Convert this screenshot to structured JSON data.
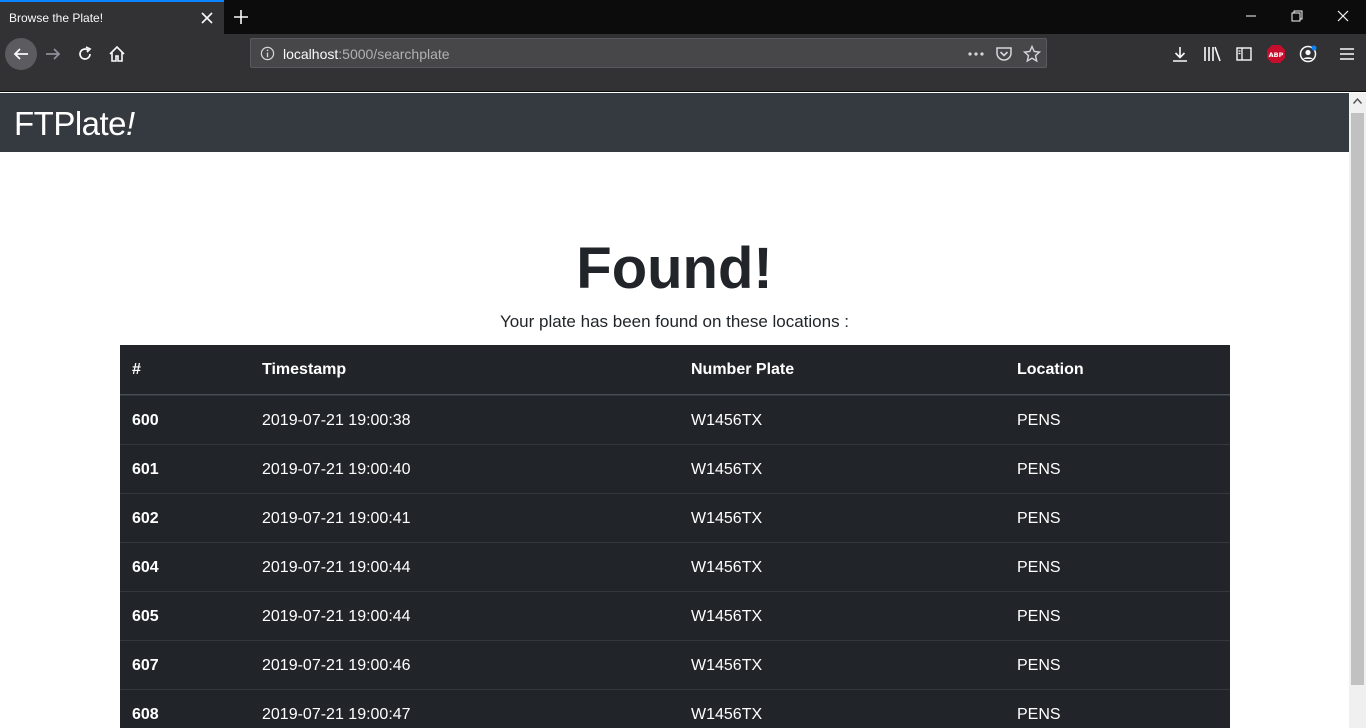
{
  "browser": {
    "tab_title": "Browse the Plate!",
    "url_host": "localhost",
    "url_rest": ":5000/searchplate"
  },
  "site": {
    "brand": "FTPlate",
    "brand_mark": "!"
  },
  "main": {
    "heading": "Found!",
    "subheading": "Your plate has been found on these locations :"
  },
  "table": {
    "headers": [
      "#",
      "Timestamp",
      "Number Plate",
      "Location"
    ],
    "rows": [
      [
        "600",
        "2019-07-21 19:00:38",
        "W1456TX",
        "PENS"
      ],
      [
        "601",
        "2019-07-21 19:00:40",
        "W1456TX",
        "PENS"
      ],
      [
        "602",
        "2019-07-21 19:00:41",
        "W1456TX",
        "PENS"
      ],
      [
        "604",
        "2019-07-21 19:00:44",
        "W1456TX",
        "PENS"
      ],
      [
        "605",
        "2019-07-21 19:00:44",
        "W1456TX",
        "PENS"
      ],
      [
        "607",
        "2019-07-21 19:00:46",
        "W1456TX",
        "PENS"
      ],
      [
        "608",
        "2019-07-21 19:00:47",
        "W1456TX",
        "PENS"
      ]
    ]
  },
  "toolbar_icons": [
    "download-icon",
    "library-icon",
    "sidebar-icon",
    "adblock-icon",
    "account-icon",
    "menu-icon"
  ]
}
